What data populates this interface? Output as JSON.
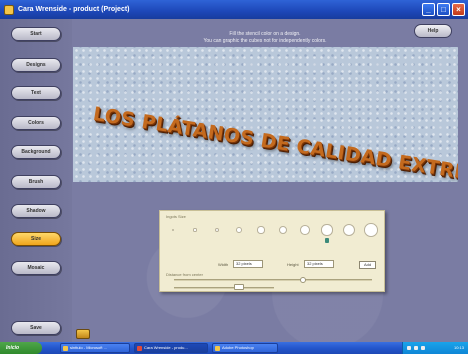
{
  "window": {
    "title": "Cara Wrenside - product (Project)",
    "buttons": [
      "_",
      "□",
      "×"
    ]
  },
  "header": {
    "line1": "Fill the stencil color on a design.",
    "line2": "You can graphic the cubes not for independently colors.",
    "help_label": "Help"
  },
  "sidebar": {
    "items": [
      {
        "label": "Start",
        "active": false
      },
      {
        "label": "Designs",
        "active": false
      },
      {
        "label": "Text",
        "active": false
      },
      {
        "label": "Colors",
        "active": false
      },
      {
        "label": "Background",
        "active": false
      },
      {
        "label": "Brush",
        "active": false
      },
      {
        "label": "Shadow",
        "active": false
      },
      {
        "label": "Size",
        "active": true
      },
      {
        "label": "Mosaic",
        "active": false
      }
    ],
    "save_label": "Save"
  },
  "banner": {
    "text": "LOS PLÁTANOS DE CALIDAD EXTREMA"
  },
  "panel": {
    "size_label": "Ingots Size",
    "width_label": "Width",
    "width_value": "32 pixels",
    "height_label": "Height",
    "height_value": "32 pixels",
    "apply_label": "Add",
    "spacing_label": "Distance from center",
    "selected_size_index": 7
  },
  "taskbar": {
    "start_label": "Inicio",
    "items": [
      {
        "label": "sinttulo - Microsoft ...",
        "active": false
      },
      {
        "label": "Cara Wrenside - produ...",
        "active": true
      },
      {
        "label": "Adobe Photoshop",
        "active": false
      }
    ],
    "clock": "10:13"
  },
  "colors": {
    "accent": "#f0a51c",
    "banner_text": "#c46a1e",
    "panel_bg": "#f1ecd2"
  }
}
